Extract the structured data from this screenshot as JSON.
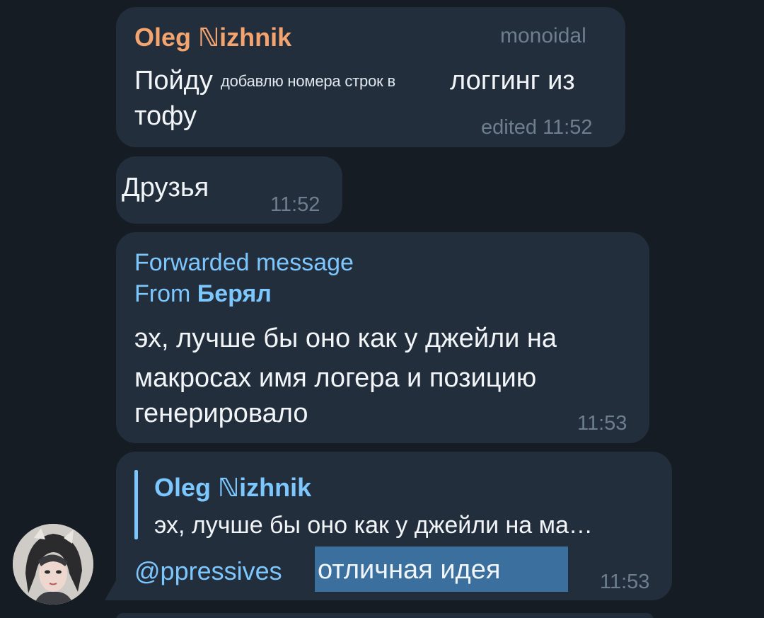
{
  "messages": {
    "msg1": {
      "sender": "Oleg ℕizhnik",
      "admin_label": "monoidal",
      "text_before": "Пойду",
      "overlay": "добавлю номера строк в",
      "text_after": "логгинг из",
      "text_line2": "тофу",
      "time": "edited 11:52"
    },
    "msg2": {
      "text": "Друзья",
      "time": "11:52"
    },
    "msg3": {
      "forward_label": "Forwarded message",
      "from_label": "From",
      "from_name": "Берял",
      "lines": [
        "эх, лучше бы оно как у джейли на",
        "макросах имя логера и позицию",
        "генерировало"
      ],
      "time": "11:53"
    },
    "msg4": {
      "reply_name": "Oleg ℕizhnik",
      "reply_text": "эх, лучше бы оно как у джейли на ма…",
      "mention": "@ppressives",
      "text": "отличная идея",
      "time": "11:53"
    }
  },
  "colors": {
    "background": "#151c24",
    "bubble": "#232e3c",
    "name_orange": "#f4a46e",
    "accent_blue": "#7dc7ff",
    "meta_gray": "#6d7f8f"
  },
  "icons": {
    "avatar": "user-avatar"
  }
}
